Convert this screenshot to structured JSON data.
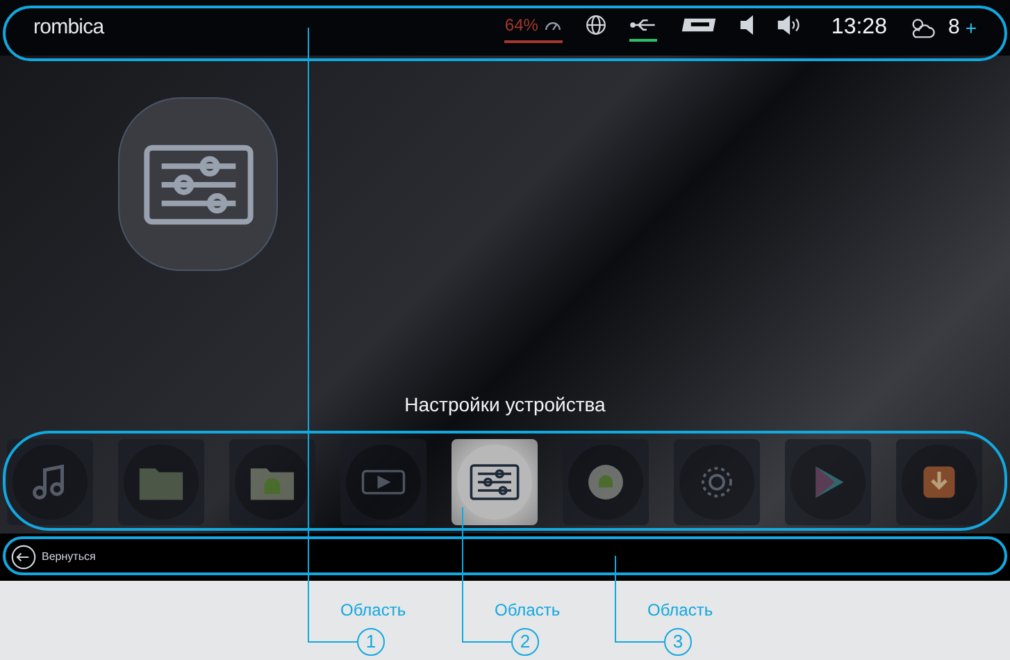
{
  "status_bar": {
    "logo": "rombica",
    "indicators": [
      {
        "kind": "battery",
        "text": "64%",
        "color": "#a5372c"
      },
      {
        "kind": "globe"
      },
      {
        "kind": "usb",
        "color": "#2bbf6a"
      },
      {
        "kind": "sd"
      },
      {
        "kind": "mute"
      },
      {
        "kind": "volume"
      }
    ],
    "time": "13:28",
    "weather_temp": "8",
    "weather_sign": "+"
  },
  "hero": {
    "title": "Настройки устройства"
  },
  "apps": [
    {
      "kind": "music",
      "selected": false
    },
    {
      "kind": "folder",
      "selected": false
    },
    {
      "kind": "android-folder",
      "selected": false
    },
    {
      "kind": "media",
      "selected": false
    },
    {
      "kind": "settings",
      "selected": true
    },
    {
      "kind": "android",
      "selected": false
    },
    {
      "kind": "gear",
      "selected": false
    },
    {
      "kind": "play",
      "selected": false
    },
    {
      "kind": "download",
      "selected": false
    }
  ],
  "bottom_bar": {
    "back_label": "Вернуться"
  },
  "callouts": [
    {
      "label": "Область",
      "number": "1"
    },
    {
      "label": "Область",
      "number": "2"
    },
    {
      "label": "Область",
      "number": "3"
    }
  ]
}
